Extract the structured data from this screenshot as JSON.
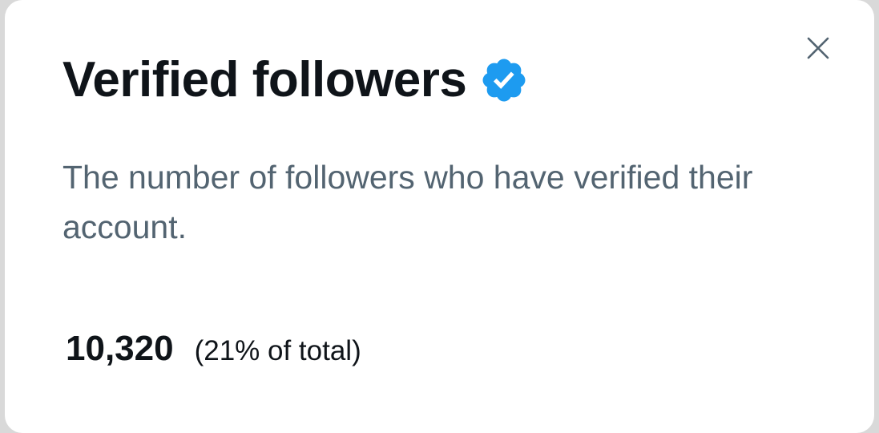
{
  "dialog": {
    "title": "Verified followers",
    "badge_icon": "verified-badge-icon",
    "badge_color": "#1d9bf0",
    "close_icon": "close-icon",
    "description": "The number of followers who have verified their account.",
    "count": "10,320",
    "percent_label": "(21% of total)"
  }
}
